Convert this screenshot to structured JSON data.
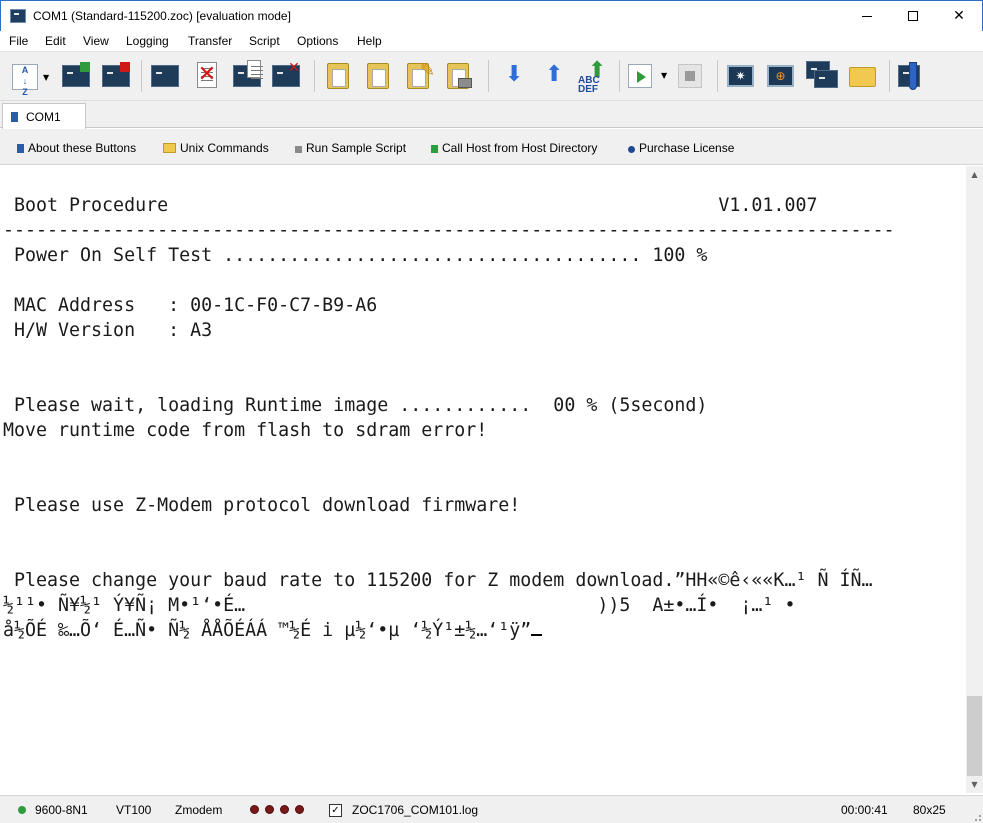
{
  "window": {
    "title": "COM1 (Standard-115200.zoc) [evaluation mode]"
  },
  "menu": {
    "items": [
      "File",
      "Edit",
      "View",
      "Logging",
      "Transfer",
      "Script",
      "Options",
      "Help"
    ]
  },
  "toolbar": {
    "icons": [
      "sort-az-icon",
      "open-session-icon",
      "close-session-icon",
      "phonebook-icon",
      "disconnect-icon",
      "log-icon",
      "log-delete-icon",
      "paste-icon",
      "paste-special-icon",
      "edit-icon",
      "print-icon",
      "download-icon",
      "upload-icon",
      "abc-def-icon",
      "run-script-icon",
      "stop-script-icon",
      "screen-star-icon",
      "screen-target-icon",
      "terminal-windows-icon",
      "folder-icon",
      "tools-icon"
    ]
  },
  "tabs": [
    {
      "label": "COM1"
    }
  ],
  "userbuttons": [
    {
      "label": "About these Buttons",
      "icon": "blue-square-icon"
    },
    {
      "label": "Unix Commands",
      "icon": "folder-icon"
    },
    {
      "label": "Run Sample Script",
      "icon": "gray-square-icon"
    },
    {
      "label": "Call Host from Host Directory",
      "icon": "green-square-icon"
    },
    {
      "label": "Purchase License",
      "icon": "blue-dot-icon"
    }
  ],
  "terminal": {
    "lines": [
      "",
      " Boot Procedure                                                  V1.01.007",
      "---------------------------------------------------------------------------------",
      " Power On Self Test ...................................... 100 %",
      "",
      " MAC Address   : 00-1C-F0-C7-B9-A6",
      " H/W Version   : A3",
      "",
      "",
      " Please wait, loading Runtime image ............  00 % (5second)",
      "Move runtime code from flash to sdram error!",
      "",
      "",
      " Please use Z-Modem protocol download firmware!",
      "",
      "",
      " Please change your baud rate to 115200 for Z modem download.”HH«©ê‹««K…¹ Ñ ÍÑ…",
      "½¹¹• Ñ¥½¹ Ý¥Ñ¡ M•¹‘•É…                                ))5  A±•…Í•  ¡…¹ •",
      "å½ÕÉ ‰…Õ‘ É…Ñ• Ñ½ ÅÅÕÉÁÁ ™½É i µ½‘•µ ‘½Ý¹±½…‘¹ÿ”"
    ]
  },
  "status": {
    "baud": "9600-8N1",
    "emulation": "VT100",
    "transfer": "Zmodem",
    "log_file": "ZOC1706_COM101.log",
    "log_checked": "✓",
    "elapsed": "00:00:41",
    "size": "80x25",
    "colors": {
      "online_dot": "#2e9b3c",
      "led": "#7a1818"
    }
  }
}
